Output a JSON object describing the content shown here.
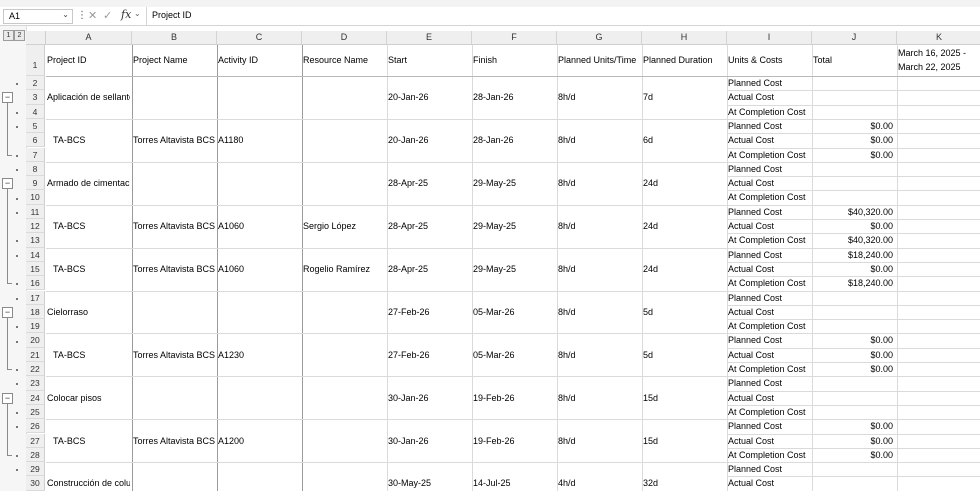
{
  "name_box": {
    "value": "A1"
  },
  "formula_bar": {
    "content": "Project ID",
    "fx_label": "fx"
  },
  "outline_levels": [
    "1",
    "2"
  ],
  "columns": [
    "A",
    "B",
    "C",
    "D",
    "E",
    "F",
    "G",
    "H",
    "I",
    "J",
    "K"
  ],
  "header_row": {
    "row_number": "1",
    "cells": [
      "Project ID",
      "Project Name",
      "Activity ID",
      "Resource Name",
      "Start",
      "Finish",
      "Planned Units/Time",
      "Planned Duration",
      "Units & Costs",
      "Total"
    ],
    "k_line1": "March 16, 2025 -",
    "k_line2": "March 22, 2025"
  },
  "groups": [
    {
      "collapse_symbol": "−",
      "rows": [
        {
          "num": "2",
          "i": "Planned Cost"
        },
        {
          "num": "3",
          "a": "Aplicación de sellante",
          "e": "20-Jan-26",
          "f": "28-Jan-26",
          "g": "8h/d",
          "h": "7d",
          "i": "Actual Cost"
        },
        {
          "num": "4",
          "i": "At Completion Cost"
        },
        {
          "num": "5",
          "i": "Planned Cost",
          "j": "$0.00"
        },
        {
          "num": "6",
          "a": "TA-BCS",
          "b": "Torres Altavista BCS",
          "c": "A1180",
          "e": "20-Jan-26",
          "f": "28-Jan-26",
          "g": "8h/d",
          "h": "6d",
          "i": "Actual Cost",
          "j": "$0.00"
        },
        {
          "num": "7",
          "i": "At Completion Cost",
          "j": "$0.00"
        }
      ]
    },
    {
      "collapse_symbol": "−",
      "rows": [
        {
          "num": "8",
          "i": "Planned Cost"
        },
        {
          "num": "9",
          "a": "Armado de cimentación",
          "e": "28-Apr-25",
          "f": "29-May-25",
          "g": "8h/d",
          "h": "24d",
          "i": "Actual Cost"
        },
        {
          "num": "10",
          "i": "At Completion Cost"
        },
        {
          "num": "11",
          "i": "Planned Cost",
          "j": "$40,320.00"
        },
        {
          "num": "12",
          "a": "TA-BCS",
          "b": "Torres Altavista BCS",
          "c": "A1060",
          "d": "Sergio López",
          "e": "28-Apr-25",
          "f": "29-May-25",
          "g": "8h/d",
          "h": "24d",
          "i": "Actual Cost",
          "j": "$0.00"
        },
        {
          "num": "13",
          "i": "At Completion Cost",
          "j": "$40,320.00"
        },
        {
          "num": "14",
          "i": "Planned Cost",
          "j": "$18,240.00"
        },
        {
          "num": "15",
          "a": "TA-BCS",
          "b": "Torres Altavista BCS",
          "c": "A1060",
          "d": "Rogelio Ramírez",
          "e": "28-Apr-25",
          "f": "29-May-25",
          "g": "8h/d",
          "h": "24d",
          "i": "Actual Cost",
          "j": "$0.00"
        },
        {
          "num": "16",
          "i": "At Completion Cost",
          "j": "$18,240.00"
        }
      ]
    },
    {
      "collapse_symbol": "−",
      "rows": [
        {
          "num": "17",
          "i": "Planned Cost"
        },
        {
          "num": "18",
          "a": "Cielorraso",
          "e": "27-Feb-26",
          "f": "05-Mar-26",
          "g": "8h/d",
          "h": "5d",
          "i": "Actual Cost"
        },
        {
          "num": "19",
          "i": "At Completion Cost"
        },
        {
          "num": "20",
          "i": "Planned Cost",
          "j": "$0.00"
        },
        {
          "num": "21",
          "a": "TA-BCS",
          "b": "Torres Altavista BCS",
          "c": "A1230",
          "e": "27-Feb-26",
          "f": "05-Mar-26",
          "g": "8h/d",
          "h": "5d",
          "i": "Actual Cost",
          "j": "$0.00"
        },
        {
          "num": "22",
          "i": "At Completion Cost",
          "j": "$0.00"
        }
      ]
    },
    {
      "collapse_symbol": "−",
      "rows": [
        {
          "num": "23",
          "i": "Planned Cost"
        },
        {
          "num": "24",
          "a": "Colocar pisos",
          "e": "30-Jan-26",
          "f": "19-Feb-26",
          "g": "8h/d",
          "h": "15d",
          "i": "Actual Cost"
        },
        {
          "num": "25",
          "i": "At Completion Cost"
        },
        {
          "num": "26",
          "i": "Planned Cost",
          "j": "$0.00"
        },
        {
          "num": "27",
          "a": "TA-BCS",
          "b": "Torres Altavista BCS",
          "c": "A1200",
          "e": "30-Jan-26",
          "f": "19-Feb-26",
          "g": "8h/d",
          "h": "15d",
          "i": "Actual Cost",
          "j": "$0.00"
        },
        {
          "num": "28",
          "i": "At Completion Cost",
          "j": "$0.00"
        }
      ]
    },
    {
      "collapse_symbol": "",
      "rows": [
        {
          "num": "29",
          "i": "Planned Cost"
        },
        {
          "num": "30",
          "a": "Construcción de columnas",
          "e": "30-May-25",
          "f": "14-Jul-25",
          "g": "4h/d",
          "h": "32d",
          "i": "Actual Cost"
        }
      ]
    }
  ]
}
